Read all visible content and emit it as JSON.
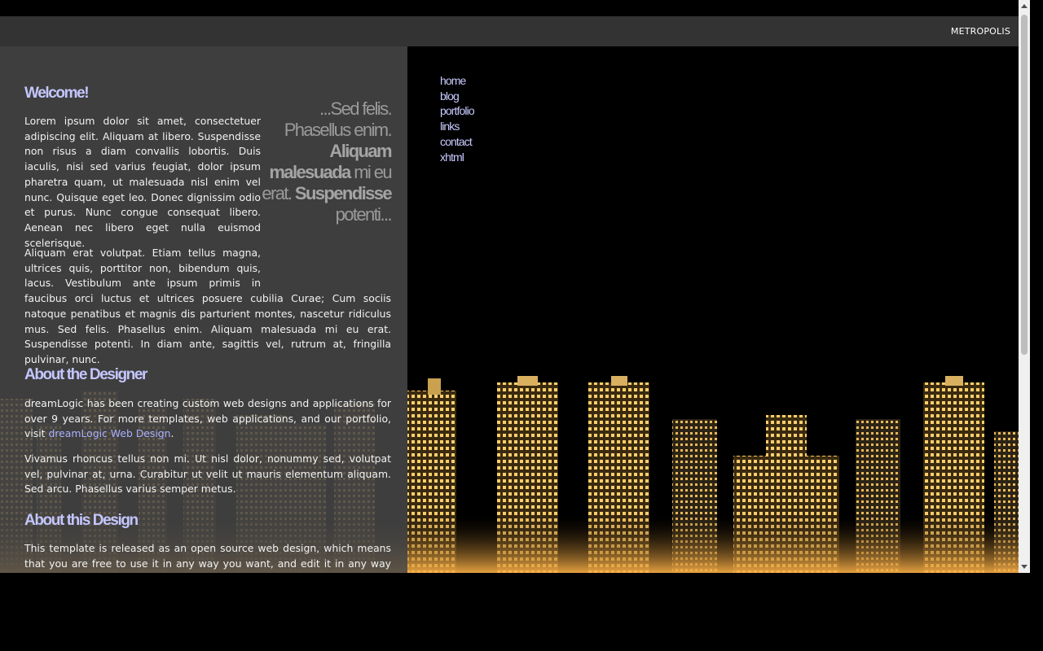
{
  "header": {
    "site_title": "METROPOLIS"
  },
  "nav": {
    "items": [
      "home",
      "blog",
      "portfolio",
      "links",
      "contact",
      "xhtml"
    ]
  },
  "sections": {
    "welcome": {
      "heading": "Welcome!",
      "para1": "Lorem ipsum dolor sit amet, consectetuer adipiscing elit. Aliquam at libero. Suspendisse non risus a diam convallis lobortis. Duis iaculis, nisi sed varius feugiat, dolor ipsum pharetra quam, ut malesuada nisl enim vel nunc. Quisque eget leo. Donec dignissim odio et purus. Nunc congue consequat libero. Aenean nec libero eget nulla euismod scelerisque.",
      "para2": "Aliquam erat volutpat. Etiam tellus magna, ultrices quis, porttitor non, bibendum quis, lacus. Vestibulum ante ipsum primis in faucibus orci luctus et ultrices posuere cubilia Curae; Cum sociis natoque penatibus et magnis dis parturient montes, nascetur ridiculus mus. Sed felis. Phasellus enim. Aliquam malesuada mi eu erat. Suspendisse potenti. In diam ante, sagittis vel, rutrum at, fringilla pulvinar, nunc."
    },
    "pullquote": {
      "p1": "...Sed felis. Phasellus enim.",
      "b1": "Aliquam malesuada",
      "p2": "mi eu erat.",
      "b2": "Suspendisse",
      "p3": "potenti..."
    },
    "designer": {
      "heading": "About the Designer",
      "para1_pre": "dreamLogic has been creating custom web designs and applications for over 9 years. For more templates, web applications, and our portfolio, visit",
      "link": "dreamLogic Web Design",
      "para1_post": ".",
      "para2": "Vivamus rhoncus tellus non mi. Ut nisl dolor, nonummy sed, volutpat vel, pulvinar at, urna. Curabitur ut velit ut mauris elementum aliquam. Sed arcu. Phasellus varius semper metus."
    },
    "design": {
      "heading": "About this Design",
      "para1": "This template is released as an open source web design, which means that you are free to use it in any way you want, and edit it in any way you"
    }
  },
  "colors": {
    "heading": "#c4c6ff",
    "nav_link": "#c8caff",
    "panel": "#484848",
    "topbar": "#333333"
  },
  "icons": {
    "scroll_up": "triangle-up-icon",
    "scroll_down": "triangle-down-icon"
  }
}
